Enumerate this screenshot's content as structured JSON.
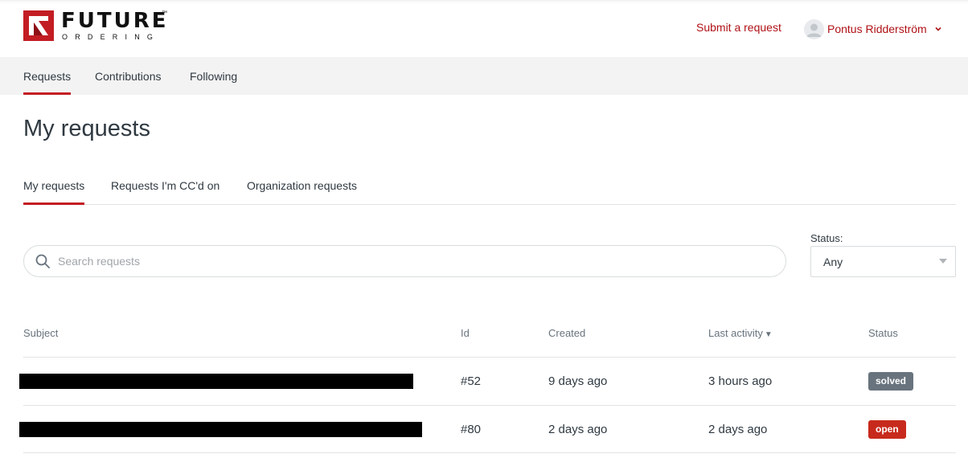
{
  "brand": {
    "name": "FUTURE",
    "subtitle": "ORDERING",
    "trademark": "™",
    "accent_color": "#c31d24",
    "link_color": "#b01116"
  },
  "header": {
    "submit_request": "Submit a request",
    "user_name": "Pontus Ridderström",
    "avatar_icon": "user-avatar-icon",
    "menu_icon": "chevron-down-icon"
  },
  "subnav": {
    "items": [
      {
        "label": "Requests",
        "active": true
      },
      {
        "label": "Contributions",
        "active": false
      },
      {
        "label": "Following",
        "active": false
      }
    ]
  },
  "page": {
    "title": "My requests"
  },
  "tabs": [
    {
      "label": "My requests",
      "active": true
    },
    {
      "label": "Requests I'm CC'd on",
      "active": false
    },
    {
      "label": "Organization requests",
      "active": false
    }
  ],
  "search": {
    "placeholder": "Search requests",
    "value": "",
    "icon": "search-icon"
  },
  "status_filter": {
    "label": "Status:",
    "selected": "Any"
  },
  "table": {
    "columns": {
      "subject": "Subject",
      "id": "Id",
      "created": "Created",
      "last_activity": "Last activity",
      "sort_indicator": "▼",
      "status": "Status"
    },
    "rows": [
      {
        "subject": "",
        "id": "#52",
        "created": "9 days ago",
        "last_activity": "3 hours ago",
        "status": "solved",
        "status_color": "#68737d"
      },
      {
        "subject": "",
        "id": "#80",
        "created": "2 days ago",
        "last_activity": "2 days ago",
        "status": "open",
        "status_color": "#c72a1c"
      }
    ]
  }
}
